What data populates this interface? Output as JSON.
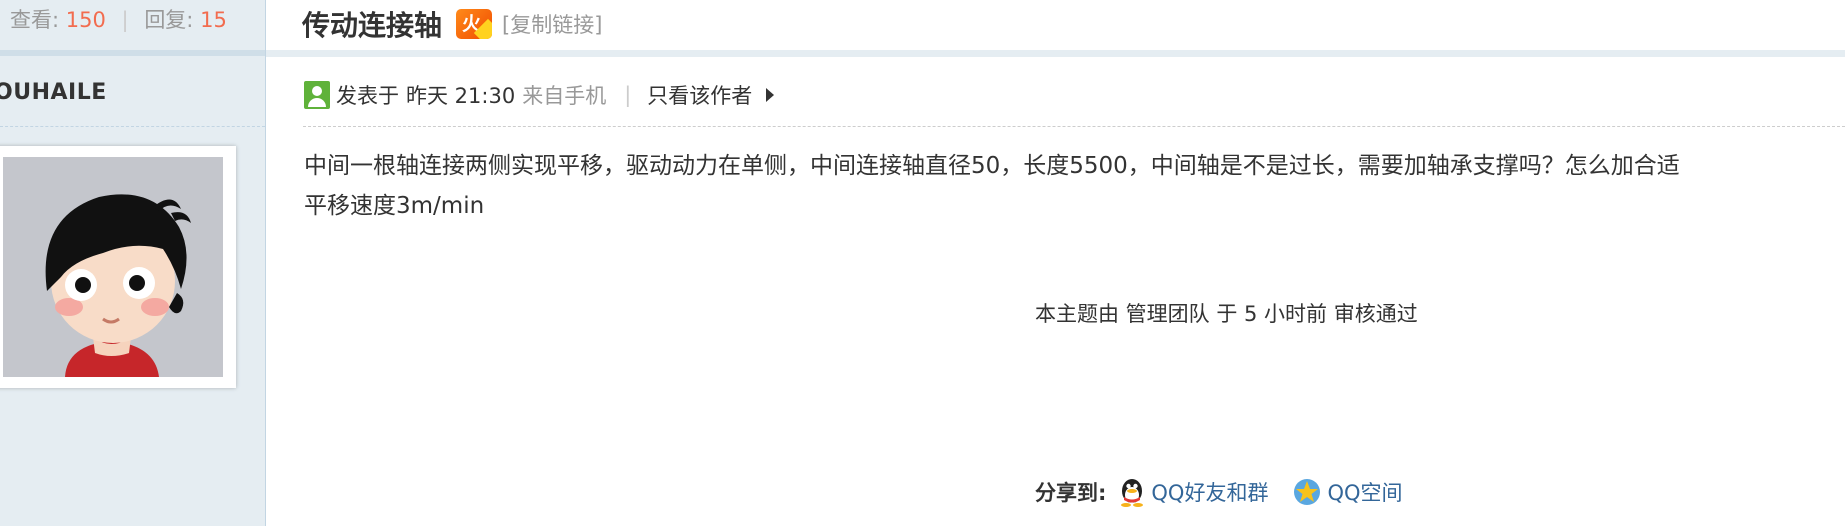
{
  "stats": {
    "views_label": "查看:",
    "views": "150",
    "replies_label": "回复:",
    "replies": "15"
  },
  "thread": {
    "title": "传动连接轴",
    "hot_badge": "火",
    "copy_link": "[复制链接]"
  },
  "author": {
    "name": "OUHAILE"
  },
  "post": {
    "posted_label": "发表于",
    "time": "昨天 21:30",
    "source": "来自手机",
    "only_author": "只看该作者",
    "body_line1": "中间一根轴连接两侧实现平移，驱动动力在单侧，中间连接轴直径50，长度5500，中间轴是不是过长，需要加轴承支撑吗？怎么加合适",
    "body_line2": "平移速度3m/min",
    "moderation": "本主题由 管理团队 于 5 小时前 审核通过"
  },
  "share": {
    "label": "分享到:",
    "qq_friends": "QQ好友和群",
    "qzone": "QQ空间"
  },
  "icons": [
    "user-icon",
    "hot-badge-icon",
    "triangle-right-icon",
    "qq-penguin-icon",
    "qzone-star-icon"
  ],
  "colors": {
    "accent_number": "#f26c4f",
    "link": "#336699",
    "sidebar_bg": "#e5edf2",
    "hot_badge": "#f04c00"
  }
}
